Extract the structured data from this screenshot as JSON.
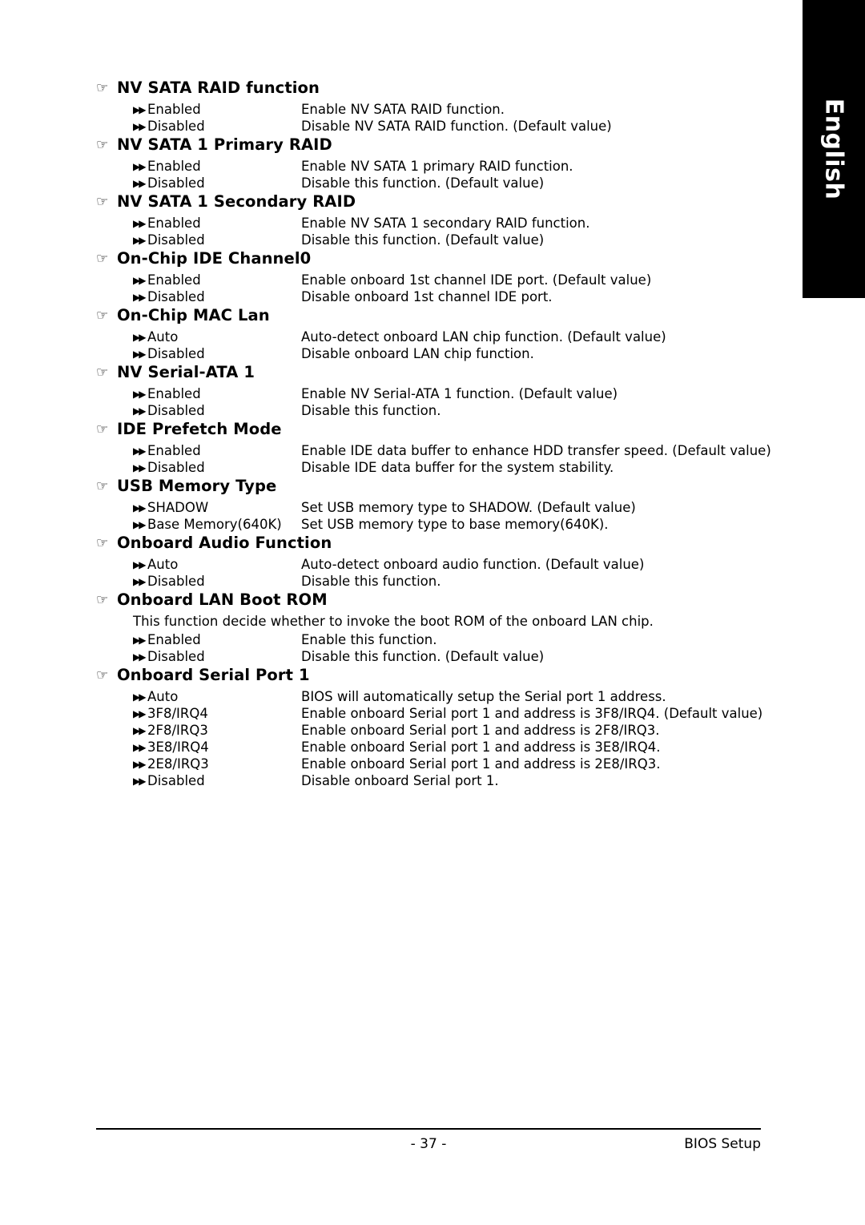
{
  "lang_tab": {
    "label": "English"
  },
  "icons": {
    "section": "☞",
    "bullet": "▶▶"
  },
  "sections": [
    {
      "title": "NV SATA RAID function",
      "note": null,
      "options": [
        {
          "label": "Enabled",
          "desc": "Enable NV SATA RAID function."
        },
        {
          "label": "Disabled",
          "desc": "Disable NV SATA RAID function. (Default value)"
        }
      ]
    },
    {
      "title": "NV SATA 1 Primary RAID",
      "note": null,
      "options": [
        {
          "label": "Enabled",
          "desc": "Enable NV SATA 1 primary RAID function."
        },
        {
          "label": "Disabled",
          "desc": "Disable this function. (Default value)"
        }
      ]
    },
    {
      "title": "NV SATA 1 Secondary RAID",
      "note": null,
      "options": [
        {
          "label": "Enabled",
          "desc": "Enable NV SATA 1 secondary RAID function."
        },
        {
          "label": "Disabled",
          "desc": "Disable this function. (Default value)"
        }
      ]
    },
    {
      "title": "On-Chip IDE Channel0",
      "note": null,
      "options": [
        {
          "label": "Enabled",
          "desc": "Enable onboard 1st channel IDE port. (Default value)"
        },
        {
          "label": "Disabled",
          "desc": "Disable onboard 1st channel IDE port."
        }
      ]
    },
    {
      "title": "On-Chip MAC Lan",
      "note": null,
      "options": [
        {
          "label": "Auto",
          "desc": "Auto-detect onboard LAN chip function. (Default value)"
        },
        {
          "label": "Disabled",
          "desc": "Disable onboard LAN chip function."
        }
      ]
    },
    {
      "title": "NV Serial-ATA 1",
      "note": null,
      "options": [
        {
          "label": "Enabled",
          "desc": "Enable NV Serial-ATA 1 function. (Default value)"
        },
        {
          "label": "Disabled",
          "desc": "Disable this function."
        }
      ]
    },
    {
      "title": "IDE Prefetch Mode",
      "note": null,
      "options": [
        {
          "label": "Enabled",
          "desc": "Enable IDE data buffer to enhance HDD transfer speed. (Default value)"
        },
        {
          "label": "Disabled",
          "desc": "Disable IDE data buffer for the system stability."
        }
      ]
    },
    {
      "title": "USB Memory Type",
      "note": null,
      "options": [
        {
          "label": "SHADOW",
          "desc": "Set USB memory type to SHADOW. (Default value)"
        },
        {
          "label": "Base Memory(640K)",
          "desc": "Set USB memory type to base memory(640K)."
        }
      ]
    },
    {
      "title": "Onboard Audio Function",
      "note": null,
      "options": [
        {
          "label": "Auto",
          "desc": "Auto-detect onboard audio function. (Default value)"
        },
        {
          "label": "Disabled",
          "desc": "Disable this function."
        }
      ]
    },
    {
      "title": "Onboard  LAN Boot ROM",
      "note": "This function decide whether to invoke the boot ROM of the onboard LAN chip.",
      "options": [
        {
          "label": "Enabled",
          "desc": "Enable this function."
        },
        {
          "label": "Disabled",
          "desc": "Disable this function. (Default value)"
        }
      ]
    },
    {
      "title": "Onboard Serial Port 1",
      "note": null,
      "options": [
        {
          "label": "Auto",
          "desc": "BIOS will automatically setup the Serial port 1 address."
        },
        {
          "label": "3F8/IRQ4",
          "desc": "Enable onboard Serial port 1 and address is 3F8/IRQ4. (Default value)"
        },
        {
          "label": "2F8/IRQ3",
          "desc": "Enable onboard Serial port 1 and address is 2F8/IRQ3."
        },
        {
          "label": "3E8/IRQ4",
          "desc": "Enable onboard Serial port 1 and address is 3E8/IRQ4."
        },
        {
          "label": "2E8/IRQ3",
          "desc": "Enable onboard Serial port 1 and address is 2E8/IRQ3."
        },
        {
          "label": "Disabled",
          "desc": "Disable onboard Serial port 1."
        }
      ]
    }
  ],
  "footer": {
    "page_number": "- 37 -",
    "right_label": "BIOS Setup"
  }
}
